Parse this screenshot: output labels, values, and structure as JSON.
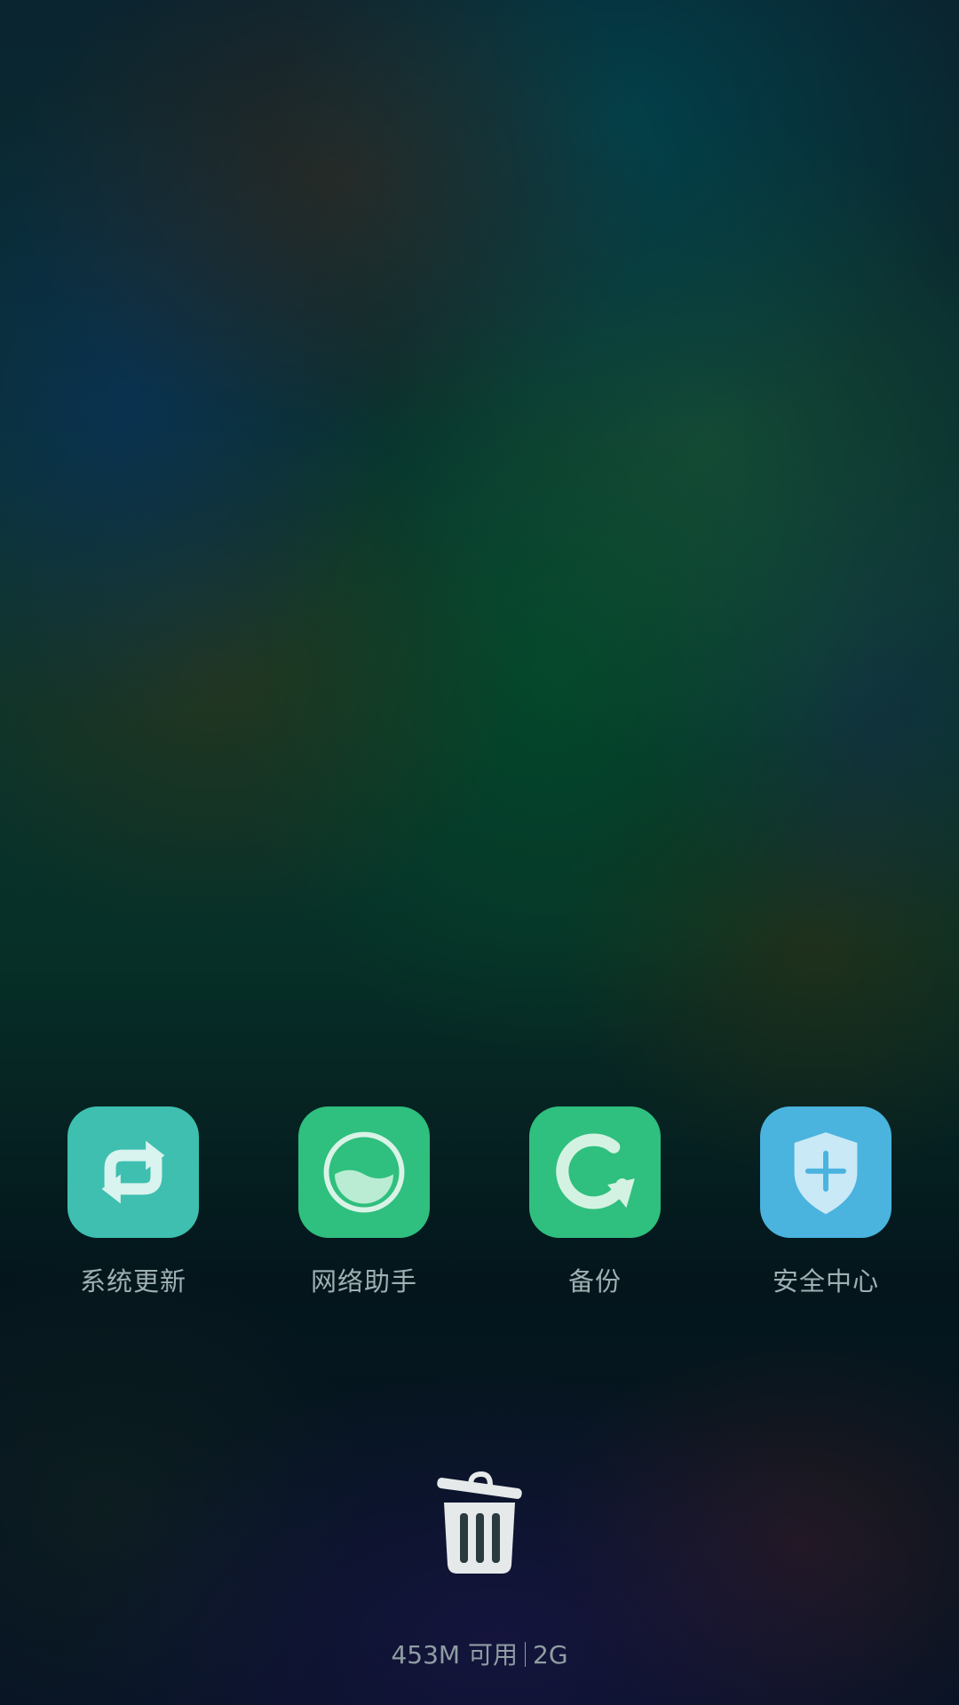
{
  "apps": [
    {
      "label": "系统更新",
      "icon": "sync-arrows-icon",
      "color": "#3ebfb0"
    },
    {
      "label": "网络助手",
      "icon": "network-gauge-icon",
      "color": "#2fbf7e"
    },
    {
      "label": "备份",
      "icon": "backup-refresh-icon",
      "color": "#2fbf7e"
    },
    {
      "label": "安全中心",
      "icon": "security-shield-icon",
      "color": "#4ab3de"
    }
  ],
  "cleanup": {
    "icon": "trash-can-icon"
  },
  "memory": {
    "available": "453M 可用",
    "total": "2G"
  }
}
